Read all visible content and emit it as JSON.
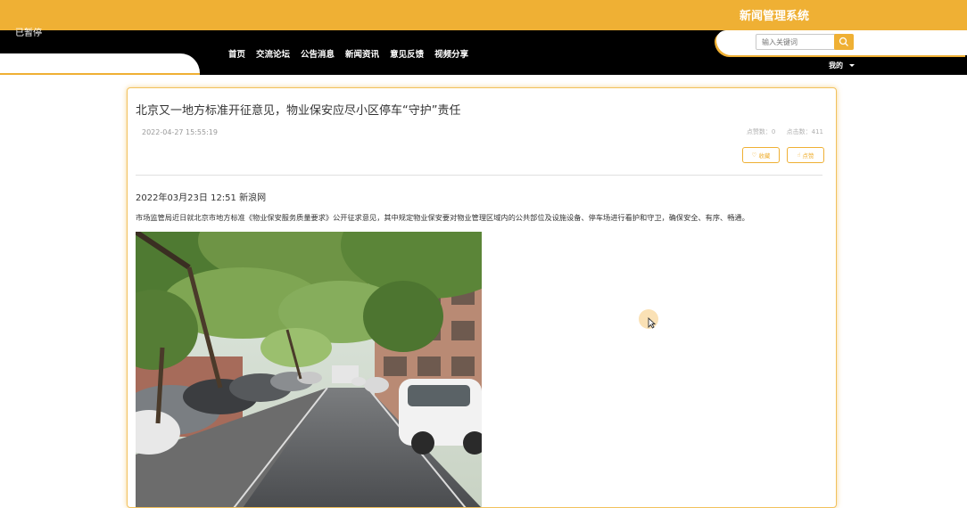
{
  "header": {
    "site_title": "新闻管理系统",
    "paused_label": "已暂停",
    "nav": [
      "首页",
      "交流论坛",
      "公告消息",
      "新闻资讯",
      "意见反馈",
      "视频分享"
    ],
    "search_placeholder": "输入关键词",
    "user_menu": "我的"
  },
  "colors": {
    "accent": "#efb034",
    "nav_bg": "#000000"
  },
  "article": {
    "title": "北京又一地方标准开征意见，物业保安应尽小区停车“守护”责任",
    "datetime": "2022-04-27 15:55:19",
    "likes_label": "点赞数：0",
    "clicks_label": "点击数：411",
    "favorite_button": "收藏",
    "like_button": "点赞",
    "source_line": "2022年03月23日 12:51 新浪网",
    "paragraph": "市场监管局近日就北京市地方标准《物业保安服务质量要求》公开征求意见，其中规定物业保安要对物业管理区域内的公共部位及设施设备、停车场进行看护和守卫，确保安全、有序、畅通。"
  }
}
